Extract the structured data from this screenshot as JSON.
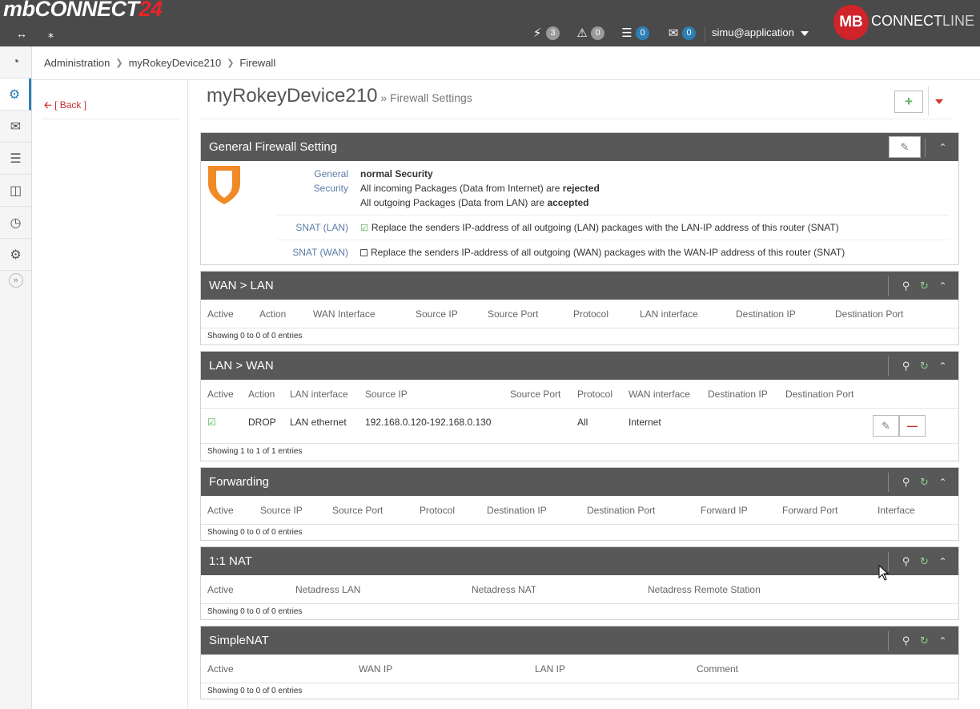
{
  "topbar": {
    "brand_main": "mbCONNECT",
    "brand_num": "24",
    "stats": [
      {
        "icon": "bolt-icon",
        "count": "3",
        "style": "grey"
      },
      {
        "icon": "warning-icon",
        "count": "0",
        "style": "grey"
      },
      {
        "icon": "server-icon",
        "count": "0",
        "style": "blue"
      },
      {
        "icon": "envelope-icon",
        "count": "0",
        "style": "blue"
      }
    ],
    "user": "simu@application",
    "logo_text": "MB",
    "logo_connect": "CONNECT",
    "logo_line": "LINE"
  },
  "breadcrumb": [
    "Administration",
    "myRokeyDevice210",
    "Firewall"
  ],
  "back_label": "[ Back ]",
  "page": {
    "title": "myRokeyDevice210",
    "subtitle": "» Firewall Settings"
  },
  "general": {
    "title": "General Firewall Setting",
    "security_label_1": "General",
    "security_label_2": "Security",
    "security_level": "normal Security",
    "incoming_prefix": "All incoming Packages (Data from Internet) are ",
    "incoming_value": "rejected",
    "outgoing_prefix": "All outgoing Packages (Data from LAN) are ",
    "outgoing_value": "accepted",
    "snat_lan_label": "SNAT (LAN)",
    "snat_lan_text": "Replace the senders IP-address of all outgoing (LAN) packages with the LAN-IP address of this router (SNAT)",
    "snat_wan_label": "SNAT (WAN)",
    "snat_wan_text": "Replace the senders IP-address of all outgoing (WAN) packages with the WAN-IP address of this router (SNAT)"
  },
  "wan_lan": {
    "title": "WAN > LAN",
    "columns": [
      "Active",
      "Action",
      "WAN Interface",
      "Source IP",
      "Source Port",
      "Protocol",
      "LAN interface",
      "Destination IP",
      "Destination Port"
    ],
    "footer": "Showing 0 to 0 of 0 entries"
  },
  "lan_wan": {
    "title": "LAN > WAN",
    "columns": [
      "Active",
      "Action",
      "LAN interface",
      "Source IP",
      "Source Port",
      "Protocol",
      "WAN interface",
      "Destination IP",
      "Destination Port"
    ],
    "rows": [
      {
        "action": "DROP",
        "lan_interface": "LAN ethernet",
        "source_ip": "192.168.0.120-192.168.0.130",
        "source_port": "",
        "protocol": "All",
        "wan_interface": "Internet",
        "destination_ip": "",
        "destination_port": ""
      }
    ],
    "footer": "Showing 1 to 1 of 1 entries"
  },
  "forwarding": {
    "title": "Forwarding",
    "columns": [
      "Active",
      "Source IP",
      "Source Port",
      "Protocol",
      "Destination IP",
      "Destination Port",
      "Forward IP",
      "Forward Port",
      "Interface"
    ],
    "footer": "Showing 0 to 0 of 0 entries"
  },
  "nat11": {
    "title": "1:1 NAT",
    "columns": [
      "Active",
      "Netadress LAN",
      "Netadress NAT",
      "Netadress Remote Station"
    ],
    "footer": "Showing 0 to 0 of 0 entries"
  },
  "simplenat": {
    "title": "SimpleNAT",
    "columns": [
      "Active",
      "WAN IP",
      "LAN IP",
      "Comment"
    ],
    "footer": "Showing 0 to 0 of 0 entries"
  },
  "colors": {
    "topbar": "#4a4a4a",
    "panel_head": "#585858",
    "accent_blue": "#2f7fb5",
    "accent_red": "#d0232a",
    "shield_orange": "#f08a24"
  }
}
